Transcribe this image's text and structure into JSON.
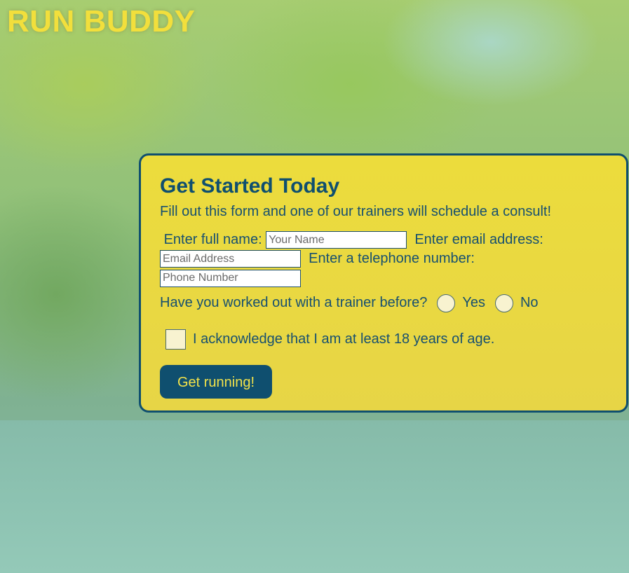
{
  "header": {
    "brand": "RUN BUDDY"
  },
  "form": {
    "title": "Get Started Today",
    "subtitle": "Fill out this form and one of our trainers will schedule a consult!",
    "name_label": "Enter full name:",
    "name_placeholder": "Your Name",
    "name_value": "",
    "email_label": "Enter email address:",
    "email_placeholder": "Email Address",
    "email_value": "",
    "phone_label": "Enter a telephone number:",
    "phone_placeholder": "Phone Number",
    "phone_value": "",
    "trainer_question": "Have you worked out with a trainer before?",
    "yes_label": "Yes",
    "no_label": "No",
    "age_ack": "I acknowledge that I am at least 18 years of age.",
    "submit_label": "Get running!"
  },
  "colors": {
    "brand_yellow": "#f2df3c",
    "card_bg": "#ecdc3c",
    "primary_blue": "#0f4f6f",
    "text_blue": "#175070"
  }
}
